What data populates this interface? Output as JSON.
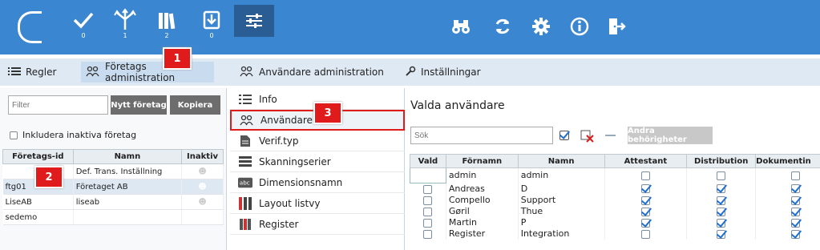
{
  "toolbar": {
    "counts": [
      "0",
      "1",
      "2",
      "0"
    ]
  },
  "tabs": [
    {
      "label": "Regler"
    },
    {
      "label": "Företags administration"
    },
    {
      "label": "Användare administration"
    },
    {
      "label": "Inställningar"
    }
  ],
  "badges": [
    "1",
    "2",
    "3"
  ],
  "left": {
    "filter_placeholder": "Filter",
    "new_company_label": "Nytt företag",
    "copy_label": "Kopiera",
    "include_inactive_label": "Inkludera inaktiva företag",
    "columns": [
      "Företags-id",
      "Namn",
      "Inaktiv"
    ],
    "rows": [
      {
        "id": "",
        "name": "Def. Trans. Inställning"
      },
      {
        "id": "ftg01",
        "name": "Företaget AB"
      },
      {
        "id": "LiseAB",
        "name": "liseab"
      },
      {
        "id": "sedemo",
        "name": ""
      }
    ]
  },
  "menu": [
    {
      "label": "Info",
      "icon": "list-icon"
    },
    {
      "label": "Användare",
      "icon": "users-icon"
    },
    {
      "label": "Verif.typ",
      "icon": "document-icon"
    },
    {
      "label": "Skanningserier",
      "icon": "stack-icon"
    },
    {
      "label": "Dimensionsnamn",
      "icon": "abc-icon"
    },
    {
      "label": "Layout listvy",
      "icon": "columns-icon"
    },
    {
      "label": "Register",
      "icon": "books-icon"
    }
  ],
  "right": {
    "title": "Valda användare",
    "search_placeholder": "Sök",
    "change_permissions_label": "Ändra behörigheter",
    "columns": [
      "Vald",
      "Förnamn",
      "Namn",
      "Attestant",
      "Distribution",
      "Dokumentin"
    ],
    "users": [
      {
        "first": "admin",
        "last": "admin",
        "attest": false,
        "dist": false,
        "dok": false
      },
      {
        "first": "Andreas",
        "last": "D",
        "attest": true,
        "dist": true,
        "dok": true
      },
      {
        "first": "Compello",
        "last": "Support",
        "attest": true,
        "dist": true,
        "dok": true
      },
      {
        "first": "Gøril",
        "last": "Thue",
        "attest": true,
        "dist": true,
        "dok": true
      },
      {
        "first": "Martin",
        "last": "P",
        "attest": true,
        "dist": true,
        "dok": true
      },
      {
        "first": "Register",
        "last": "Integration",
        "attest": false,
        "dist": true,
        "dok": true
      }
    ]
  },
  "colors": {
    "accent": "#3b86d1",
    "active": "#2a5d93",
    "badge": "#e01b1b"
  }
}
